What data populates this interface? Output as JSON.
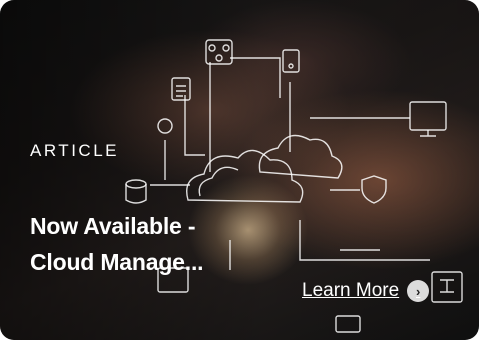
{
  "card": {
    "eyebrow": "ARTICLE",
    "title_line1": "Now Available -",
    "title_line2": "Cloud Manage...",
    "cta_label": "Learn More",
    "cta_icon": "chevron-right-icon",
    "accent_color": "#ffffff"
  }
}
